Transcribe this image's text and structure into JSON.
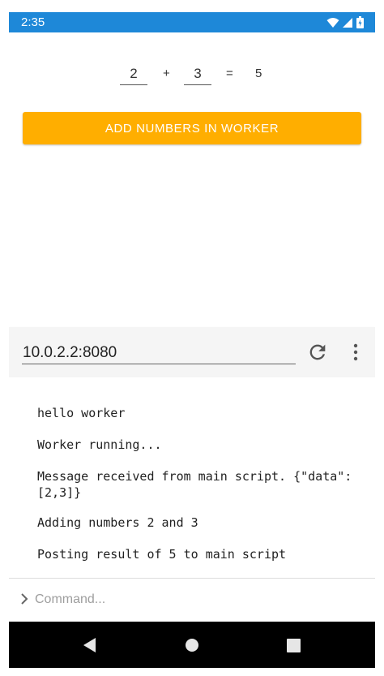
{
  "status_bar": {
    "time": "2:35"
  },
  "calculator": {
    "a": "2",
    "plus": "+",
    "b": "3",
    "equals": "=",
    "result": "5"
  },
  "button": {
    "label": "ADD NUMBERS IN WORKER",
    "color": "#ffae00"
  },
  "address_bar": {
    "url": "10.0.2.2:8080"
  },
  "console": {
    "logs": [
      "hello worker",
      "Worker running...",
      "Message received from main script. {\"data\":\n[2,3]}",
      "Adding numbers 2 and 3",
      "Posting result of 5 to main script"
    ]
  },
  "command": {
    "placeholder": "Command..."
  },
  "colors": {
    "status_bar": "#1e88d8",
    "nav_bar": "#000000"
  },
  "icons": [
    "wifi-icon",
    "signal-icon",
    "battery-icon",
    "reload-icon",
    "more-vert-icon",
    "chevron-right-icon",
    "back-icon",
    "home-icon",
    "recents-icon"
  ]
}
